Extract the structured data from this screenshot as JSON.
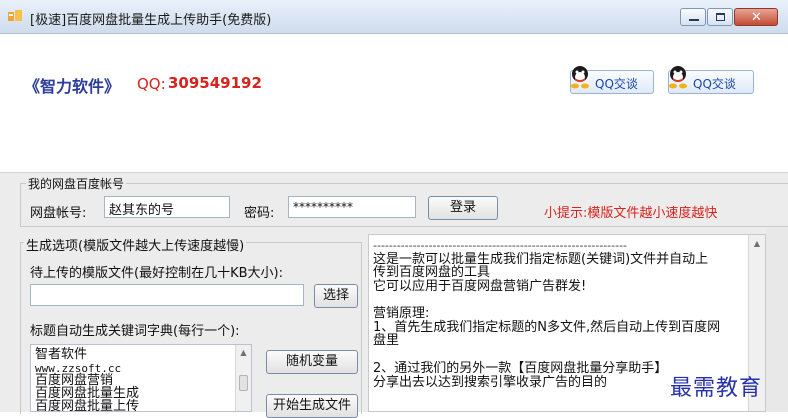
{
  "window": {
    "title": "[极速]百度网盘批量生成上传助手(免费版)",
    "icon": "app-icon",
    "controls": [
      "minimize-icon",
      "maximize-icon",
      "close-icon"
    ],
    "close_color": "#c24a34"
  },
  "header": {
    "brand": "《智力软件》",
    "qq_label": "QQ:",
    "qq_number": "309549192",
    "qq_buttons": [
      {
        "label": "QQ交谈"
      },
      {
        "label": "QQ交谈"
      }
    ],
    "brand_color": "#2b3c9a",
    "accent_color": "#d8221c"
  },
  "account": {
    "group_label": "我的网盘百度帐号",
    "username_label": "网盘帐号:",
    "username_value": "赵其东的号",
    "password_label": "密码:",
    "password_value": "**********",
    "login_button": "登录",
    "hint": "小提示:模版文件越小速度越快"
  },
  "options": {
    "group_label": "生成选项(模版文件越大上传速度越慢)",
    "template_label": "待上传的模版文件(最好控制在几十KB大小):",
    "template_value": "",
    "browse_button": "选择",
    "keywords_label": "标题自动生成关键词字典(每行一个):",
    "keywords": [
      "智者软件",
      "www.zzsoft.cc",
      "百度网盘营销",
      "百度网盘批量生成",
      "百度网盘批量上传"
    ],
    "random_button": "随机变量",
    "start_button": "开始生成文件"
  },
  "info": {
    "lines": [
      "----------------------------------------------------------------",
      "这是一款可以批量生成我们指定标题(关键词)文件并自动上",
      "传到百度网盘的工具",
      "它可以应用于百度网盘营销广告群发!",
      "",
      "营销原理:",
      "1、首先生成我们指定标题的N多文件,然后自动上传到百度网",
      "盘里",
      "",
      "2、通过我们的另外一款【百度网盘批量分享助手】",
      "分享出去以达到搜索引擎收录广告的目的"
    ]
  },
  "watermark": "最需教育"
}
